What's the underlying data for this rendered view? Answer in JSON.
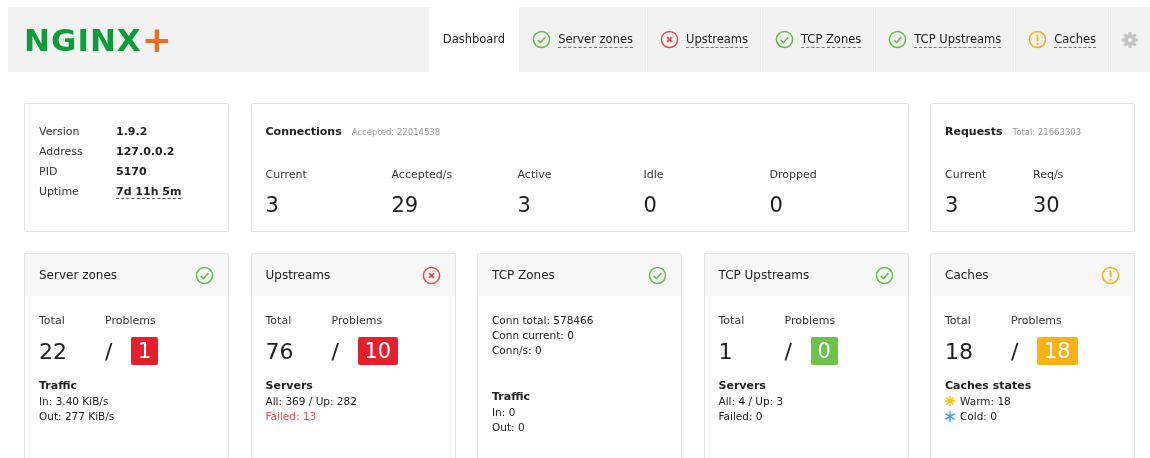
{
  "logo": {
    "text": "NGINX",
    "mark": "+"
  },
  "tabs": [
    {
      "label": "Dashboard",
      "selected": true,
      "kind": "plain"
    },
    {
      "label": "Server zones",
      "selected": false,
      "kind": "ok"
    },
    {
      "label": "Upstreams",
      "selected": false,
      "kind": "error"
    },
    {
      "label": "TCP Zones",
      "selected": false,
      "kind": "ok"
    },
    {
      "label": "TCP Upstreams",
      "selected": false,
      "kind": "ok"
    },
    {
      "label": "Caches",
      "selected": false,
      "kind": "warning"
    }
  ],
  "info": [
    {
      "label": "Version",
      "value": "1.9.2",
      "dotted": false
    },
    {
      "label": "Address",
      "value": "127.0.0.2",
      "dotted": false
    },
    {
      "label": "PID",
      "value": "5170",
      "dotted": false
    },
    {
      "label": "Uptime",
      "value": "7d 11h 5m",
      "dotted": true
    }
  ],
  "connections": {
    "title": "Connections",
    "note": "Accepted: 22014538",
    "metrics": [
      {
        "label": "Current",
        "value": "3"
      },
      {
        "label": "Accepted/s",
        "value": "29"
      },
      {
        "label": "Active",
        "value": "3"
      },
      {
        "label": "Idle",
        "value": "0"
      },
      {
        "label": "Dropped",
        "value": "0"
      }
    ]
  },
  "requests": {
    "title": "Requests",
    "note": "Total: 21663303",
    "metrics": [
      {
        "label": "Current",
        "value": "3"
      },
      {
        "label": "Req/s",
        "value": "30"
      }
    ]
  },
  "cards": [
    {
      "title": "Server zones",
      "status_icon": {
        "kind": "ok"
      },
      "kind": "totals",
      "total_label": "Total",
      "problems_label": "Problems",
      "total": "22",
      "separator": "/",
      "problems": {
        "value": "1",
        "color": "#e5202e"
      },
      "section": "Traffic",
      "lines": [
        {
          "text": "In: 3.40 KiB/s",
          "kind": "plain"
        },
        {
          "text": "Out: 277 KiB/s",
          "kind": "plain"
        }
      ]
    },
    {
      "title": "Upstreams",
      "status_icon": {
        "kind": "error"
      },
      "kind": "totals",
      "total_label": "Total",
      "problems_label": "Problems",
      "total": "76",
      "separator": "/",
      "problems": {
        "value": "10",
        "color": "#e5202e"
      },
      "section": "Servers",
      "lines": [
        {
          "text": "All: 369 / Up: 282",
          "kind": "plain"
        },
        {
          "text": "Failed: 13",
          "kind": "failed"
        }
      ]
    },
    {
      "title": "TCP Zones",
      "status_icon": {
        "kind": "ok"
      },
      "kind": "stats",
      "stats": [
        "Conn total: 578466",
        "Conn current: 0",
        "Conn/s: 0"
      ],
      "section": "Traffic",
      "lines": [
        {
          "text": "In: 0",
          "kind": "plain"
        },
        {
          "text": "Out: 0",
          "kind": "plain"
        }
      ]
    },
    {
      "title": "TCP Upstreams",
      "status_icon": {
        "kind": "ok"
      },
      "kind": "totals",
      "total_label": "Total",
      "problems_label": "Problems",
      "total": "1",
      "separator": "/",
      "problems": {
        "value": "0",
        "color": "#6cc24a"
      },
      "section": "Servers",
      "lines": [
        {
          "text": "All: 4 / Up: 3",
          "kind": "plain"
        },
        {
          "text": "Failed: 0",
          "kind": "plain"
        }
      ]
    },
    {
      "title": "Caches",
      "status_icon": {
        "kind": "warning"
      },
      "kind": "totals",
      "total_label": "Total",
      "problems_label": "Problems",
      "total": "18",
      "separator": "/",
      "problems": {
        "value": "18",
        "color": "#fbb116"
      },
      "section": "Caches states",
      "lines": [
        {
          "text": "Warm: 18",
          "kind": "warm"
        },
        {
          "text": "Cold: 0",
          "kind": "cold"
        }
      ]
    }
  ]
}
